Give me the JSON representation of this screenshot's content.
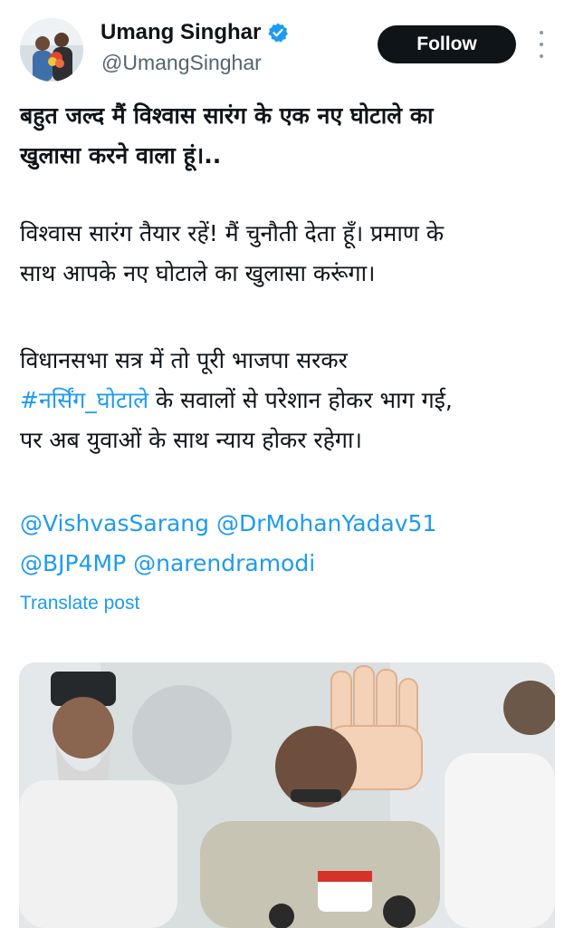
{
  "author": {
    "display_name": "Umang Singhar",
    "handle": "@UmangSinghar",
    "verified": true,
    "avatar": "profile-photo"
  },
  "follow_label": "Follow",
  "tweet": {
    "para1": [
      "बहुत जल्द मैं विश्वास सारंग के एक नए घोटाले का",
      "खुलासा करने वाला हूं।.."
    ],
    "para2": [
      "विश्वास सारंग तैयार रहें! मैं चुनौती देता हूँ। प्रमाण के",
      "साथ आपके नए घोटाले का खुलासा करूंगा।"
    ],
    "para3": {
      "line1": "विधानसभा सत्र में तो पूरी भाजपा सरकर",
      "hashtag": "#नर्सिंग_घोटाले",
      "line2_rest": " के सवालों से परेशान होकर भाग गई,",
      "line3": "पर अब युवाओं के साथ न्याय होकर रहेगा।"
    },
    "mentions": {
      "m1": "@VishvasSarang",
      "m2": "@DrMohanYadav51",
      "m3": "@BJP4MP",
      "m4": "@narendramodi"
    }
  },
  "translate_label": "Translate post",
  "media": {
    "description_icon": "press-conference-photo"
  },
  "colors": {
    "link": "#1d9bf0",
    "text": "#0f1419",
    "secondary": "#536471",
    "follow_bg": "#0f1419"
  }
}
